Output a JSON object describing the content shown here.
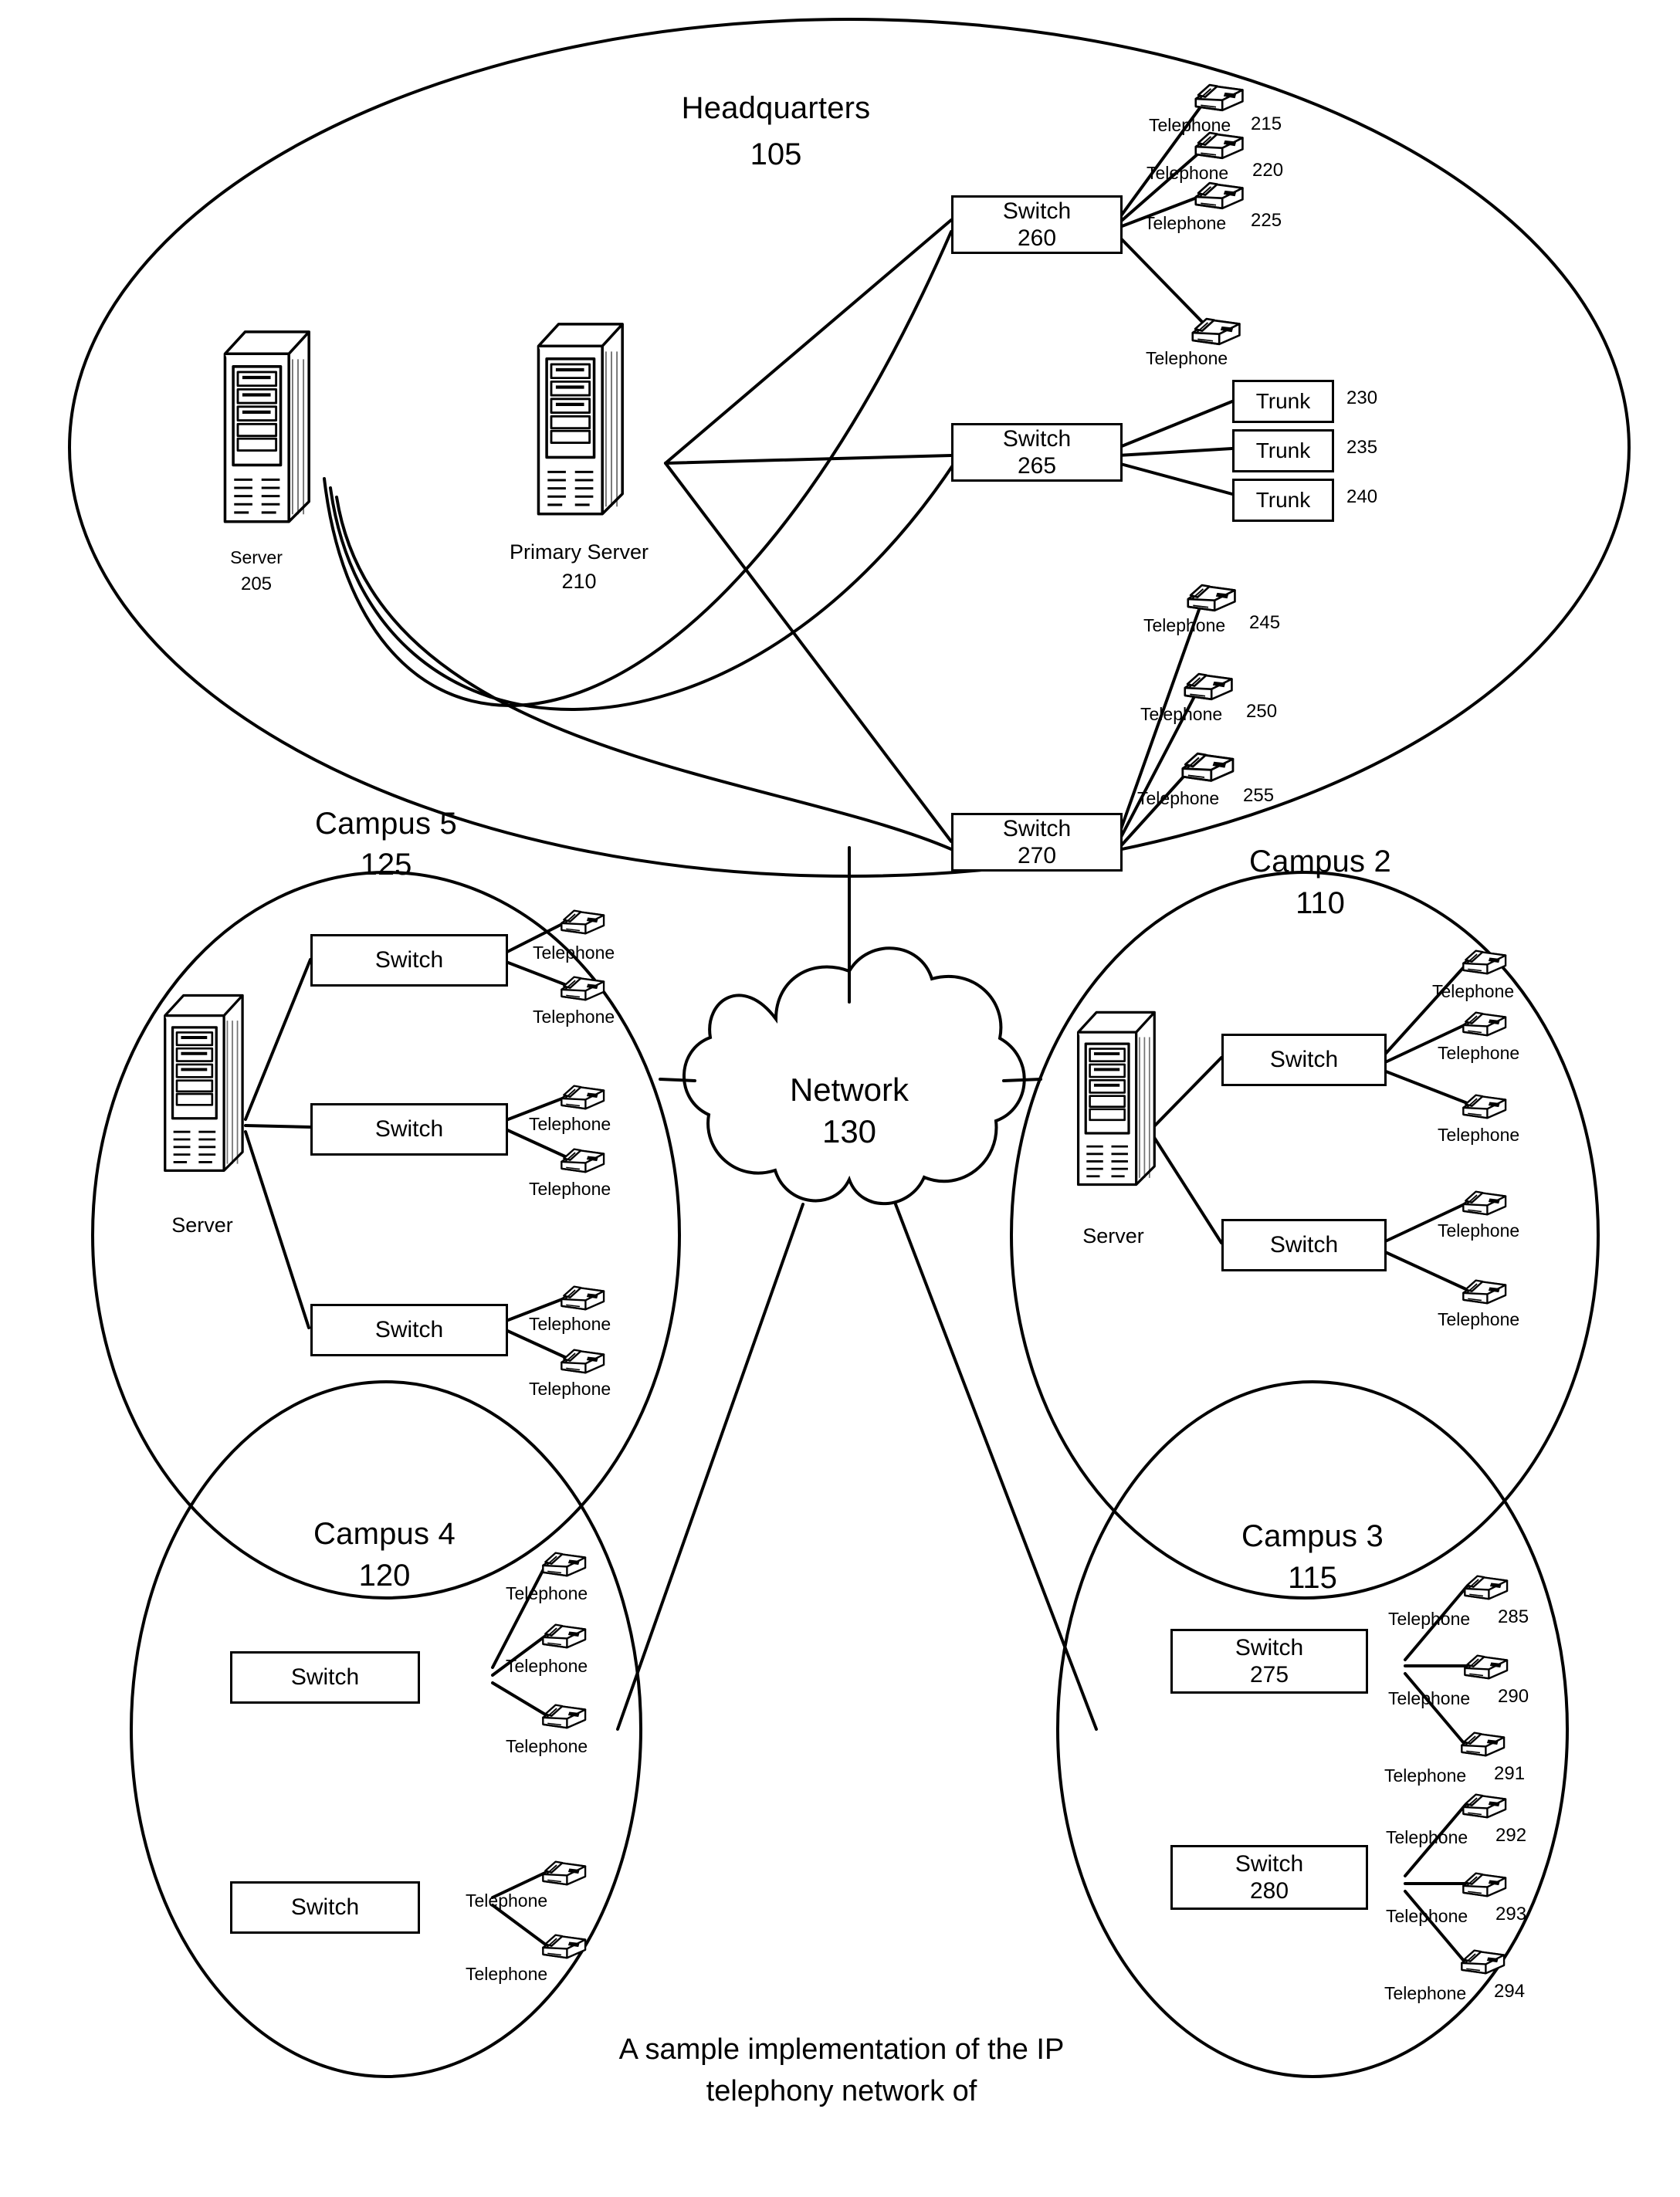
{
  "figure": {
    "caption_line1": "A sample implementation of the IP",
    "caption_line2": "telephony network of"
  },
  "zones": {
    "headquarters": {
      "title": "Headquarters",
      "number": "105"
    },
    "campus5": {
      "title": "Campus 5",
      "number": "125"
    },
    "campus2": {
      "title": "Campus 2",
      "number": "110"
    },
    "campus4": {
      "title": "Campus 4",
      "number": "120"
    },
    "campus3": {
      "title": "Campus 3",
      "number": "115"
    }
  },
  "cloud": {
    "title": "Network",
    "number": "130"
  },
  "headquarters": {
    "servers": [
      {
        "label": "Server",
        "number": "205"
      },
      {
        "label": "Primary Server",
        "number": "210"
      }
    ],
    "switches": [
      {
        "label": "Switch",
        "number": "260"
      },
      {
        "label": "Switch",
        "number": "265"
      },
      {
        "label": "Switch",
        "number": "270"
      }
    ],
    "phones_top": [
      {
        "label": "Telephone",
        "number": "215"
      },
      {
        "label": "Telephone",
        "number": "220"
      },
      {
        "label": "Telephone",
        "number": "225"
      },
      {
        "label": "Telephone",
        "number": ""
      }
    ],
    "trunks": [
      {
        "label": "Trunk",
        "number": "230"
      },
      {
        "label": "Trunk",
        "number": "235"
      },
      {
        "label": "Trunk",
        "number": "240"
      }
    ],
    "phones_bottom": [
      {
        "label": "Telephone",
        "number": "245"
      },
      {
        "label": "Telephone",
        "number": "250"
      },
      {
        "label": "Telephone",
        "number": "255"
      }
    ]
  },
  "campus5": {
    "server": {
      "label": "Server"
    },
    "switches": [
      {
        "label": "Switch",
        "phones": [
          {
            "label": "Telephone"
          },
          {
            "label": "Telephone"
          }
        ]
      },
      {
        "label": "Switch",
        "phones": [
          {
            "label": "Telephone"
          },
          {
            "label": "Telephone"
          }
        ]
      },
      {
        "label": "Switch",
        "phones": [
          {
            "label": "Telephone"
          },
          {
            "label": "Telephone"
          }
        ]
      }
    ]
  },
  "campus2": {
    "server": {
      "label": "Server"
    },
    "switches": [
      {
        "label": "Switch",
        "phones": [
          {
            "label": "Telephone"
          },
          {
            "label": "Telephone"
          },
          {
            "label": "Telephone"
          }
        ]
      },
      {
        "label": "Switch",
        "phones": [
          {
            "label": "Telephone"
          },
          {
            "label": "Telephone"
          }
        ]
      }
    ]
  },
  "campus4": {
    "switches": [
      {
        "label": "Switch",
        "phones": [
          {
            "label": "Telephone"
          },
          {
            "label": "Telephone"
          },
          {
            "label": "Telephone"
          }
        ]
      },
      {
        "label": "Switch",
        "phones": [
          {
            "label": "Telephone"
          },
          {
            "label": "Telephone"
          }
        ]
      }
    ]
  },
  "campus3": {
    "switches": [
      {
        "label": "Switch",
        "number": "275",
        "phones": [
          {
            "label": "Telephone",
            "number": "285"
          },
          {
            "label": "Telephone",
            "number": "290"
          },
          {
            "label": "Telephone",
            "number": "291"
          }
        ]
      },
      {
        "label": "Switch",
        "number": "280",
        "phones": [
          {
            "label": "Telephone",
            "number": "292"
          },
          {
            "label": "Telephone",
            "number": "293"
          },
          {
            "label": "Telephone",
            "number": "294"
          }
        ]
      }
    ]
  },
  "colors": {
    "ink": "#000000",
    "paper": "#ffffff"
  }
}
